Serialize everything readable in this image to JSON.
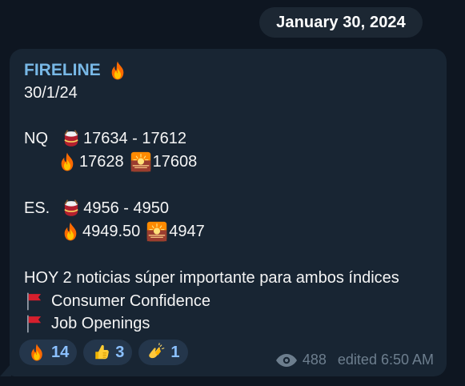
{
  "date_separator": {
    "label": "January 30, 2024"
  },
  "message": {
    "channel_name": "FIRELINE",
    "header_icon": "fire-icon",
    "lines": {
      "date": "30/1/24",
      "nq_label": "NQ",
      "nq_range": "17634 - 17612",
      "nq_fire_value": "17628",
      "nq_sunset_value": "17608",
      "es_label": "ES.",
      "es_range": "4956 - 4950",
      "es_fire_value": "4949.50",
      "es_sunset_value": "4947",
      "news_heading": "HOY 2 noticias súper importante para ambos índices",
      "news_1": "Consumer Confidence",
      "news_2": "Job Openings"
    },
    "icons": {
      "drum": "drum-icon",
      "fire": "fire-icon",
      "sunset": "sunset-icon",
      "flag": "red-flag-icon"
    },
    "reactions": [
      {
        "icon": "fire-icon",
        "count": "14"
      },
      {
        "icon": "thumbs-up-icon",
        "count": "3"
      },
      {
        "icon": "clapping-hands-icon",
        "count": "1"
      }
    ],
    "views": "488",
    "edited_label": "edited 6:50 AM"
  },
  "colors": {
    "background": "#0e1621",
    "bubble": "#182533",
    "date_pill": "#1c2733",
    "channel_name": "#78b8e6",
    "reaction_bg": "#24364b",
    "reaction_text": "#8bc0ff",
    "meta_text": "#6d7e8e"
  }
}
